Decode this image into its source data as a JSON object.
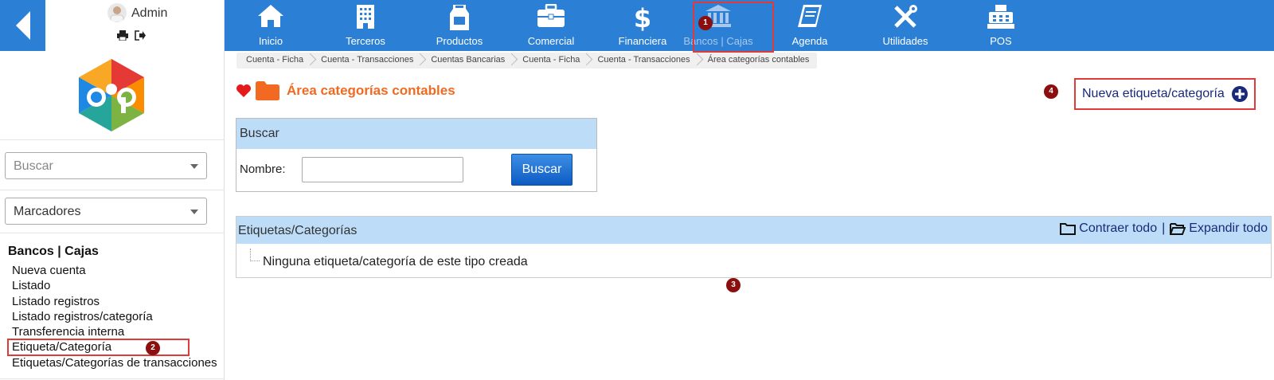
{
  "user": {
    "name": "Admin"
  },
  "sidebar": {
    "search_placeholder": "Buscar",
    "bookmarks_label": "Marcadores",
    "section_title": "Bancos | Cajas",
    "items": [
      "Nueva cuenta",
      "Listado",
      "Listado registros",
      "Listado registros/categoría",
      "Transferencia interna",
      "Etiqueta/Categoría",
      "Etiquetas/Categorías de transacciones"
    ]
  },
  "nav": {
    "items": [
      {
        "label": "Inicio",
        "icon": "home-icon"
      },
      {
        "label": "Terceros",
        "icon": "building-icon"
      },
      {
        "label": "Productos",
        "icon": "milk-carton-icon"
      },
      {
        "label": "Comercial",
        "icon": "briefcase-icon"
      },
      {
        "label": "Financiera",
        "icon": "dollar-icon"
      },
      {
        "label": "Bancos | Cajas",
        "icon": "bank-icon"
      },
      {
        "label": "Agenda",
        "icon": "book-icon"
      },
      {
        "label": "Utilidades",
        "icon": "tools-icon"
      },
      {
        "label": "POS",
        "icon": "cash-register-icon"
      }
    ],
    "active": "Bancos | Cajas"
  },
  "breadcrumb": [
    "Cuenta - Ficha",
    "Cuenta - Transacciones",
    "Cuentas Bancarias",
    "Cuenta - Ficha",
    "Cuenta - Transacciones",
    "Área categorías contables"
  ],
  "page": {
    "title": "Área categorías contables",
    "new_button": "Nueva etiqueta/categoría"
  },
  "search": {
    "header": "Buscar",
    "name_label": "Nombre:",
    "name_value": "",
    "button": "Buscar"
  },
  "tree": {
    "header": "Etiquetas/Categorías",
    "collapse_all": "Contraer todo",
    "separator": "|",
    "expand_all": "Expandir todo",
    "empty_message": "Ninguna etiqueta/categoría de este tipo creada"
  },
  "annotations": {
    "n1": "1",
    "n2": "2",
    "n3": "3",
    "n4": "4"
  },
  "colors": {
    "primary": "#2b80d6",
    "accent": "#f26a21",
    "highlight": "#e03b3b",
    "badge": "#8b0f0f",
    "panel_header": "#bcdcf7"
  }
}
